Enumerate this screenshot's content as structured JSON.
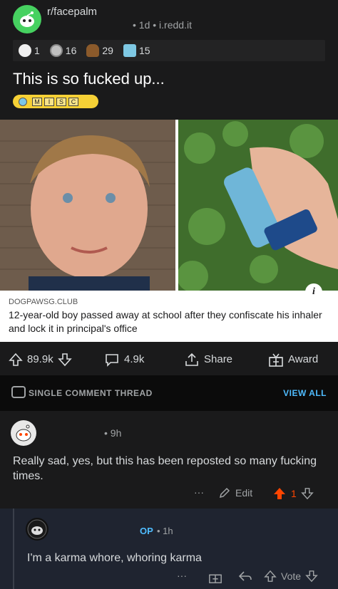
{
  "post": {
    "subreddit": "r/facepalm",
    "meta": "• 1d • i.redd.it",
    "awards": [
      {
        "icon": "wholesome-award-icon",
        "count": "1"
      },
      {
        "icon": "silver-award-icon",
        "count": "16"
      },
      {
        "icon": "poop-award-icon",
        "count": "29"
      },
      {
        "icon": "confused-award-icon",
        "count": "15"
      }
    ],
    "title": "This is so fucked up...",
    "flair_letters": [
      "M",
      "I",
      "S",
      "C"
    ],
    "link": {
      "domain": "DOGPAWSG.CLUB",
      "title": "12-year-old boy passed away at school after they confiscate his inhaler and lock it in principal's office",
      "info": "i"
    },
    "actions": {
      "upvotes": "89.9k",
      "comments": "4.9k",
      "share": "Share",
      "award": "Award"
    }
  },
  "thread": {
    "label": "SINGLE COMMENT THREAD",
    "view_all": "VIEW ALL"
  },
  "comment1": {
    "meta": "• 9h",
    "text": "Really sad, yes, but this has been reposted so many fucking times.",
    "more": "···",
    "edit": "Edit",
    "score": "1"
  },
  "comment2": {
    "op": "OP",
    "meta": "• 1h",
    "text": "I'm a karma whore, whoring karma",
    "more": "···",
    "vote": "Vote"
  },
  "colors": {
    "accent_blue": "#4fbcff",
    "upvote_orange": "#ff4500",
    "flair_yellow": "#f6d136"
  }
}
